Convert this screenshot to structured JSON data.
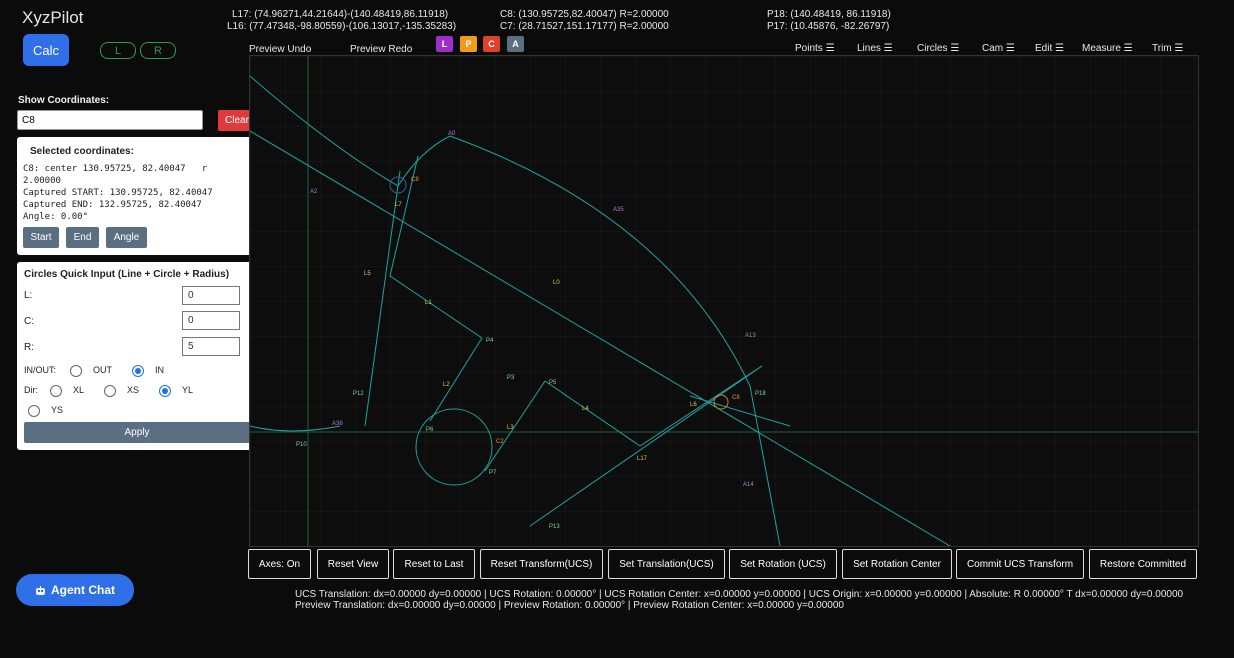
{
  "app": {
    "title": "XyzPilot"
  },
  "header": {
    "calc_label": "Calc",
    "left_pill": "L",
    "right_pill": "R",
    "info": {
      "l17": "L17: (74.96271,44.21644)-(140.48419,86.11918)",
      "l16": "L16: (77.47348,-98.80559)-(106.13017,-135.35283)",
      "c8": "C8: (130.95725,82.40047) R=2.00000",
      "c7": "C7: (28.71527,151.17177) R=2.00000",
      "p18": "P18: (140.48419, 86.11918)",
      "p17": "P17: (10.45876, -82.26797)"
    },
    "preview_undo": "Preview Undo",
    "preview_redo": "Preview Redo",
    "mode_chips": [
      {
        "label": "L",
        "color": "#9b30c8"
      },
      {
        "label": "P",
        "color": "#f29a1a"
      },
      {
        "label": "C",
        "color": "#e0402c"
      },
      {
        "label": "A",
        "color": "#5a6f82"
      }
    ],
    "menus": [
      "Points ☰",
      "Lines ☰",
      "Circles ☰",
      "Cam ☰",
      "Edit ☰",
      "Measure ☰",
      "Trim ☰"
    ]
  },
  "left_panel": {
    "show_coords_label": "Show Coordinates:",
    "coords_value": "C8",
    "clear_label": "Clear",
    "selected_title": "Selected coordinates:",
    "selected_text": "C8: center 130.95725, 82.40047   r\n2.00000\nCaptured START: 130.95725, 82.40047\nCaptured END: 132.95725, 82.40047\nAngle: 0.00°",
    "start_label": "Start",
    "end_label": "End",
    "angle_label": "Angle"
  },
  "circles_quick": {
    "title": "Circles Quick Input (Line + Circle + Radius)",
    "l_label": "L:",
    "l_value": "0",
    "c_label": "C:",
    "c_value": "0",
    "r_label": "R:",
    "r_value": "5",
    "inout_label": "IN/OUT:",
    "out_label": "OUT",
    "in_label": "IN",
    "dir_label": "Dir:",
    "xl_label": "XL",
    "xs_label": "XS",
    "yl_label": "YL",
    "ys_label": "YS",
    "apply_label": "Apply"
  },
  "canvas_labels": {
    "A0": "A0",
    "A2": "A2",
    "A35": "A35",
    "A13": "A13",
    "A14": "A14",
    "A36": "A36",
    "C8": "C8",
    "C2": "C2",
    "L7": "L7",
    "L5": "L5",
    "L1": "L1",
    "L0": "L0",
    "L2": "L2",
    "L3": "L3",
    "L4": "L4",
    "L6": "L6",
    "L17": "L17",
    "P4": "P4",
    "P3": "P3",
    "P5": "P5",
    "P12": "P12",
    "P6": "P6",
    "P7": "P7",
    "P10": "P10",
    "P13": "P13",
    "P18": "P18"
  },
  "toolbar": {
    "buttons": [
      "Axes: On",
      "Reset View",
      "Reset to Last",
      "Reset Transform(UCS)",
      "Set Translation(UCS)",
      "Set Rotation (UCS)",
      "Set Rotation Center",
      "Commit UCS Transform",
      "Restore Committed"
    ]
  },
  "status": {
    "line1": "UCS Translation: dx=0.00000 dy=0.00000 | UCS Rotation: 0.00000° | UCS Rotation Center: x=0.00000 y=0.00000 | UCS Origin: x=0.00000 y=0.00000 | Absolute: R 0.00000° T dx=0.00000 dy=0.00000",
    "line2": "Preview Translation: dx=0.00000 dy=0.00000 | Preview Rotation: 0.00000° | Preview Rotation Center: x=0.00000 y=0.00000"
  },
  "agent_chat": {
    "label": "Agent Chat",
    "icon": "robot-icon"
  },
  "colors": {
    "accent": "#2f6fe8",
    "clear": "#e03b3b",
    "geometry": "#1fa3a0"
  }
}
